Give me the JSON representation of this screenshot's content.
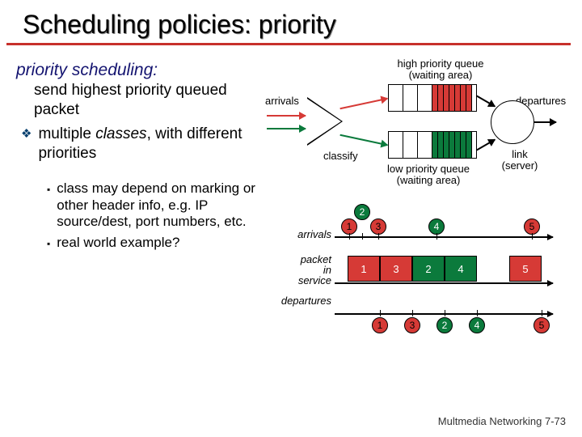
{
  "title": "Scheduling policies: priority",
  "definition": {
    "term": "priority scheduling:",
    "body": "send highest priority queued packet"
  },
  "bullet1": {
    "text": "multiple classes, with different priorities",
    "keyword": "classes"
  },
  "sub1": "class may depend on marking or other header info, e.g. IP source/dest, port numbers, etc.",
  "sub2": "real world example?",
  "queue": {
    "high_label": "high priority queue\n(waiting area)",
    "low_label": "low priority queue\n(waiting area)",
    "arrivals": "arrivals",
    "departures": "departures",
    "classify": "classify",
    "link": "link\n(server)"
  },
  "timeline": {
    "arrivals": "arrivals",
    "packet_in_service": "packet\nin\nservice",
    "departures": "departures",
    "packets": [
      "1",
      "2",
      "3",
      "4",
      "5"
    ]
  },
  "footer": "Multmedia Networking  7-73"
}
